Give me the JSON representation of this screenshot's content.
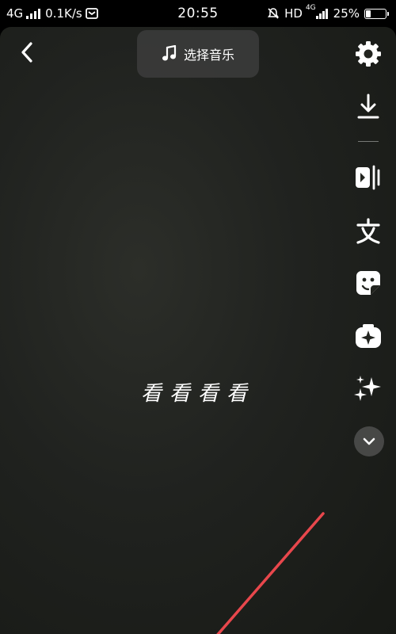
{
  "status_bar": {
    "network": "4G",
    "speed": "0.1K/s",
    "time": "20:55",
    "hd_label": "HD",
    "network_right": "4G",
    "battery": "25%",
    "battery_level": 0.25
  },
  "music": {
    "label": "选择音乐",
    "icon": "music-note-icon"
  },
  "toolbar": {
    "icons": [
      "gear-icon",
      "download-icon",
      "flip-icon",
      "text-icon",
      "sticker-icon",
      "effects-icon",
      "sparkle-icon",
      "chevron-down-icon"
    ]
  },
  "caption": {
    "text": "看看看看"
  },
  "colors": {
    "accent_line": "#e8474c",
    "background": "#1f211d"
  }
}
